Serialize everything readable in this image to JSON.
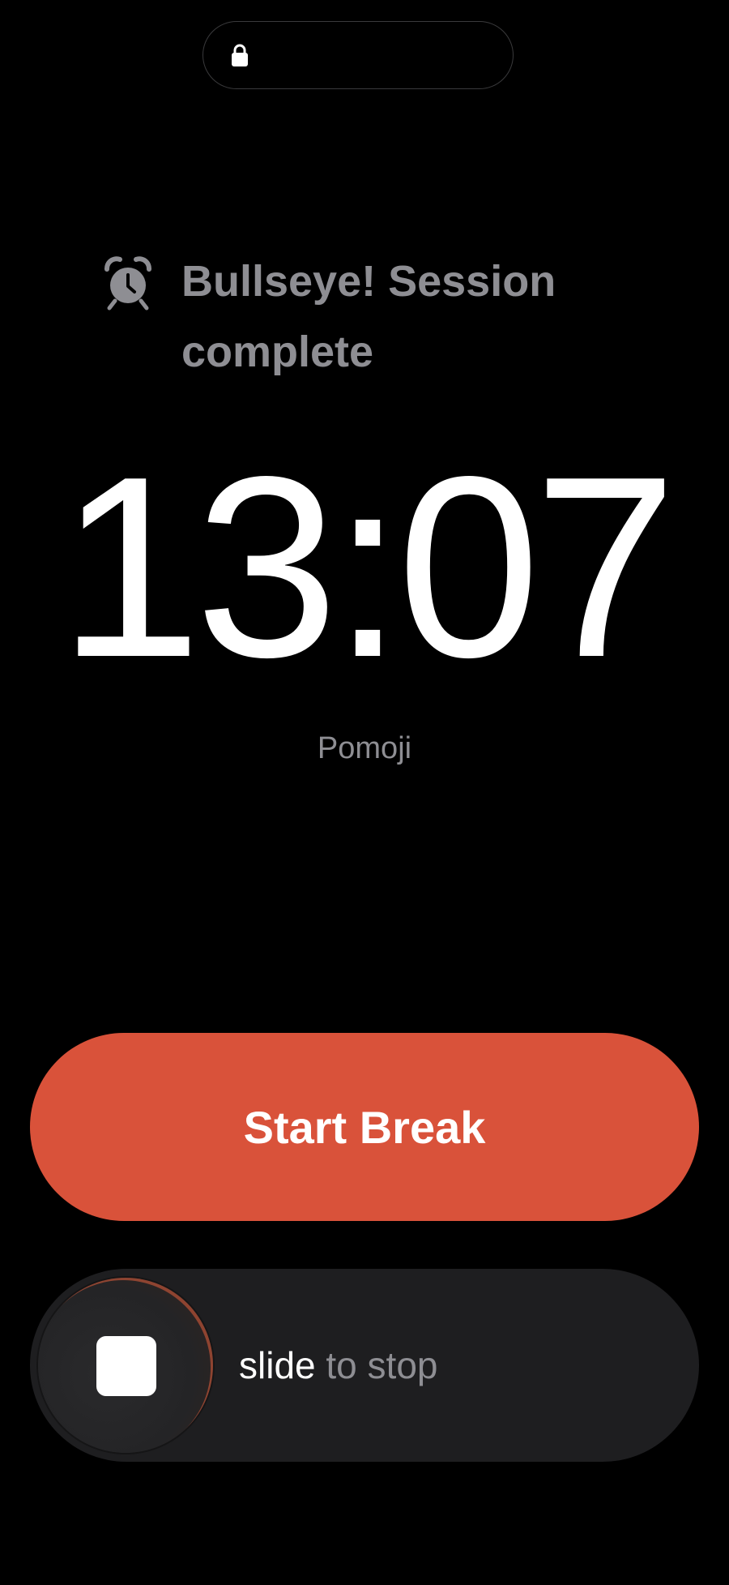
{
  "dynamic_island": {
    "icon": "lock-icon"
  },
  "alarm": {
    "icon": "alarm-clock-icon",
    "title": "Bullseye! Session complete"
  },
  "time": "13:07",
  "app_name": "Pomoji",
  "start_break": {
    "label": "Start Break",
    "color": "#d9523a"
  },
  "slider": {
    "word_highlight": "slide",
    "word_rest": " to stop",
    "knob_icon": "stop-square-icon"
  },
  "colors": {
    "background": "#000000",
    "muted_text": "#8e8e93",
    "accent": "#d9523a",
    "track": "#1e1e20"
  }
}
